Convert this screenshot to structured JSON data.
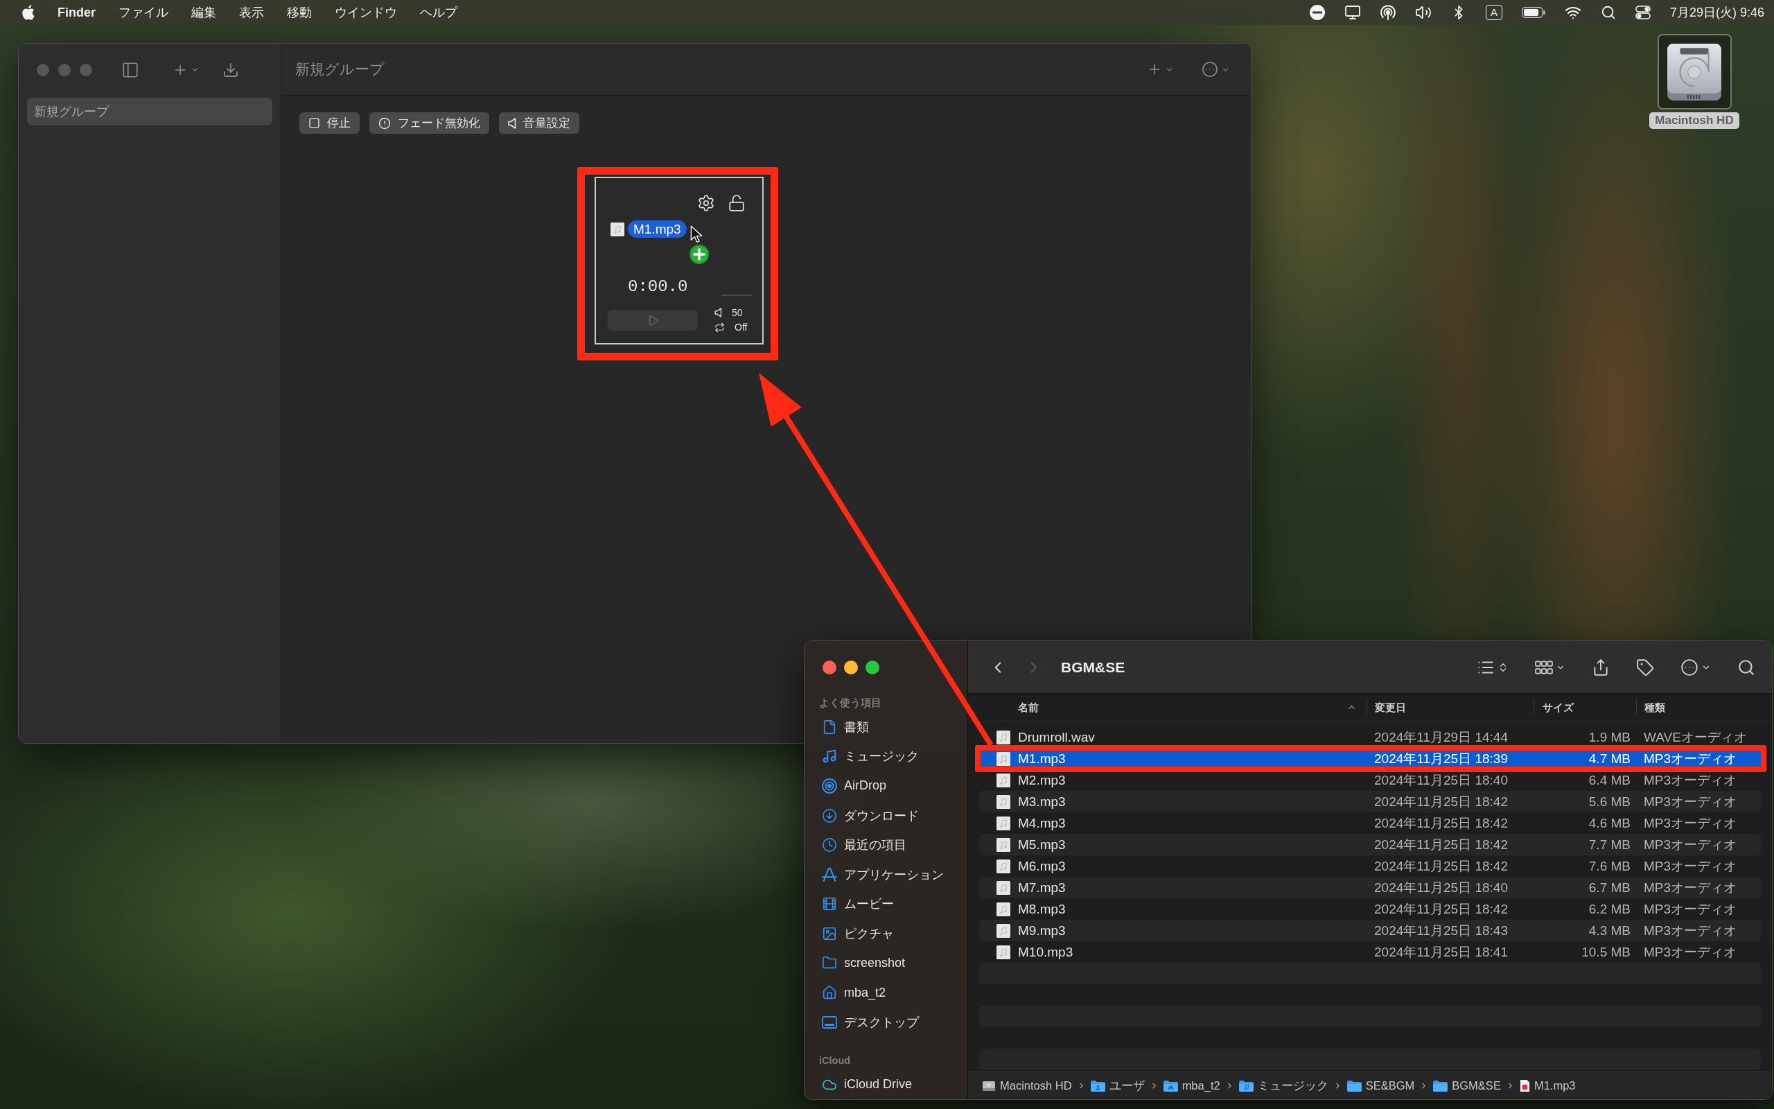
{
  "menu_bar": {
    "app_name": "Finder",
    "menus": [
      "ファイル",
      "編集",
      "表示",
      "移動",
      "ウインドウ",
      "ヘルプ"
    ],
    "input_source": "A",
    "clock": "7月29日(火) 9:46"
  },
  "desktop_icons": [
    {
      "label": "Macintosh HD",
      "selected": true
    }
  ],
  "app_window": {
    "active": false,
    "sidebar_items": [
      {
        "label": "新規グループ",
        "selected": true
      }
    ],
    "title": "新規グループ",
    "toolbar_buttons": [
      {
        "label": "停止",
        "kind": "stop"
      },
      {
        "label": "フェード無効化",
        "kind": "fade"
      },
      {
        "label": "音量設定",
        "kind": "volume"
      }
    ],
    "cue": {
      "time": "0:00.0",
      "volume": "50",
      "loop": "Off",
      "locked": false,
      "play_disabled": true
    },
    "drag_item": {
      "label": "M1.mp3"
    }
  },
  "finder": {
    "active": true,
    "title": "BGM&SE",
    "back_disabled": false,
    "forward_disabled": true,
    "sidebar_sections": [
      {
        "heading": "よく使う項目",
        "items": [
          {
            "label": "書類",
            "kind": "document"
          },
          {
            "label": "ミュージック",
            "kind": "music"
          },
          {
            "label": "AirDrop",
            "kind": "airdrop"
          },
          {
            "label": "ダウンロード",
            "kind": "download"
          },
          {
            "label": "最近の項目",
            "kind": "recent"
          },
          {
            "label": "アプリケーション",
            "kind": "applications"
          },
          {
            "label": "ムービー",
            "kind": "movies"
          },
          {
            "label": "ピクチャ",
            "kind": "pictures"
          },
          {
            "label": "screenshot",
            "kind": "folder"
          },
          {
            "label": "mba_t2",
            "kind": "home"
          },
          {
            "label": "デスクトップ",
            "kind": "desktop"
          }
        ]
      },
      {
        "heading": "iCloud",
        "items": [
          {
            "label": "iCloud Drive",
            "kind": "cloud"
          }
        ]
      }
    ],
    "columns": [
      {
        "label": "名前",
        "sorted": true
      },
      {
        "label": "変更日",
        "sorted": false
      },
      {
        "label": "サイズ",
        "sorted": false
      },
      {
        "label": "種類",
        "sorted": false
      }
    ],
    "rows": [
      {
        "name": "Drumroll.wav",
        "modified": "2024年11月29日 14:44",
        "size": "1.9 MB",
        "file_type": "WAVEオーディオ",
        "selected": false
      },
      {
        "name": "M1.mp3",
        "modified": "2024年11月25日 18:39",
        "size": "4.7 MB",
        "file_type": "MP3オーディオ",
        "selected": true
      },
      {
        "name": "M2.mp3",
        "modified": "2024年11月25日 18:40",
        "size": "6.4 MB",
        "file_type": "MP3オーディオ",
        "selected": false
      },
      {
        "name": "M3.mp3",
        "modified": "2024年11月25日 18:42",
        "size": "5.6 MB",
        "file_type": "MP3オーディオ",
        "selected": false
      },
      {
        "name": "M4.mp3",
        "modified": "2024年11月25日 18:42",
        "size": "4.6 MB",
        "file_type": "MP3オーディオ",
        "selected": false
      },
      {
        "name": "M5.mp3",
        "modified": "2024年11月25日 18:42",
        "size": "7.7 MB",
        "file_type": "MP3オーディオ",
        "selected": false
      },
      {
        "name": "M6.mp3",
        "modified": "2024年11月25日 18:42",
        "size": "7.6 MB",
        "file_type": "MP3オーディオ",
        "selected": false
      },
      {
        "name": "M7.mp3",
        "modified": "2024年11月25日 18:40",
        "size": "6.7 MB",
        "file_type": "MP3オーディオ",
        "selected": false
      },
      {
        "name": "M8.mp3",
        "modified": "2024年11月25日 18:42",
        "size": "6.2 MB",
        "file_type": "MP3オーディオ",
        "selected": false
      },
      {
        "name": "M9.mp3",
        "modified": "2024年11月25日 18:43",
        "size": "4.3 MB",
        "file_type": "MP3オーディオ",
        "selected": false
      },
      {
        "name": "M10.mp3",
        "modified": "2024年11月25日 18:41",
        "size": "10.5 MB",
        "file_type": "MP3オーディオ",
        "selected": false
      }
    ],
    "path": [
      {
        "label": "Macintosh HD",
        "kind": "disk"
      },
      {
        "label": "ユーザ",
        "kind": "users"
      },
      {
        "label": "mba_t2",
        "kind": "home"
      },
      {
        "label": "ミュージック",
        "kind": "music"
      },
      {
        "label": "SE&BGM",
        "kind": "folder"
      },
      {
        "label": "BGM&SE",
        "kind": "folder"
      },
      {
        "label": "M1.mp3",
        "kind": "audio-file"
      }
    ]
  }
}
